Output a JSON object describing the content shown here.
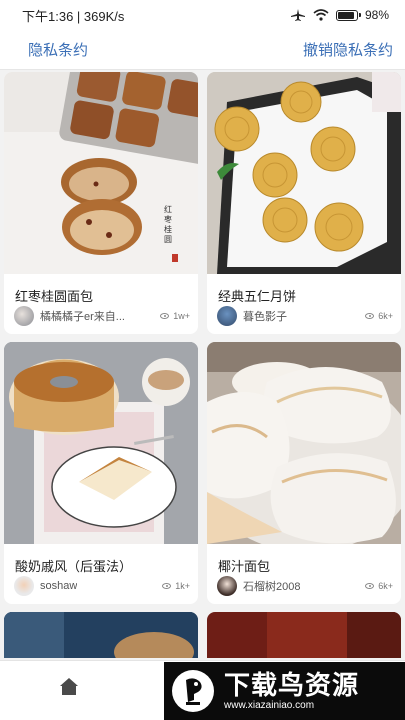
{
  "status_bar": {
    "time": "下午1:36 | 369K/s",
    "battery": "98"
  },
  "top_bar": {
    "privacy_link": "隐私条约",
    "revoke_link": "撤销隐私条约"
  },
  "recipes": [
    {
      "title": "红枣桂圆面包",
      "author": "橘橘橘子er来自...",
      "views": "1w+"
    },
    {
      "title": "经典五仁月饼",
      "author": "暮色影子",
      "views": "6k+"
    },
    {
      "title": "酸奶戚风（后蛋法）",
      "author": "soshaw",
      "views": "1k+"
    },
    {
      "title": "椰汁面包",
      "author": "石榴树2008",
      "views": "6k+"
    }
  ],
  "bottom_nav": {
    "items": [
      "home-icon"
    ]
  },
  "watermark": {
    "text": "下载鸟资源",
    "url": "www.xiazainiao.com"
  }
}
